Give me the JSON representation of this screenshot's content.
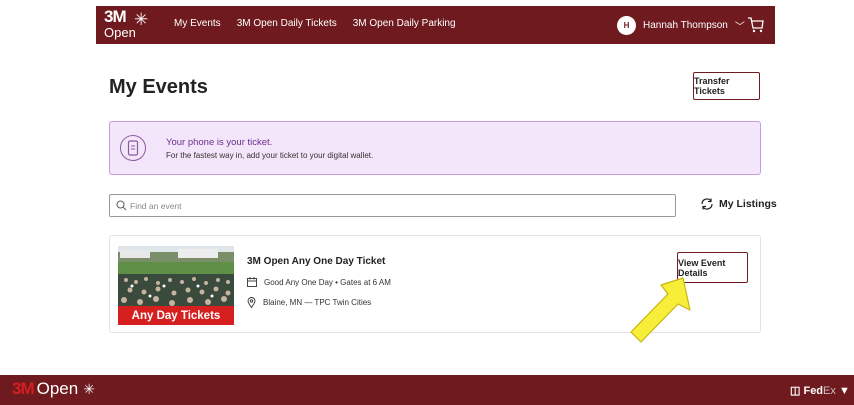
{
  "header": {
    "logo_line1": "3M",
    "logo_line2": "Open",
    "nav": [
      "My Events",
      "3M Open Daily Tickets",
      "3M Open Daily Parking"
    ],
    "user_initial": "H",
    "user_name": "Hannah Thompson",
    "brand_color": "#6e1a1e"
  },
  "page": {
    "title": "My Events",
    "transfer_button": "Transfer Tickets"
  },
  "banner": {
    "title": "Your phone is your ticket.",
    "subtitle": "For the fastest way in, add your ticket to your digital wallet.",
    "icon": "phone-icon"
  },
  "search": {
    "placeholder": "Find an event",
    "value": ""
  },
  "listings_label": "My Listings",
  "event": {
    "image_badge": "Any Day Tickets",
    "title": "3M Open Any One Day Ticket",
    "date_line": "Good Any One Day • Gates at 6 AM",
    "location_line": "Blaine, MN — TPC Twin Cities",
    "details_button": "View Event Details"
  },
  "footer": {
    "logo_m": "3M",
    "logo_open": "Open",
    "sponsor_fed": "Fed",
    "sponsor_ex": "Ex"
  }
}
